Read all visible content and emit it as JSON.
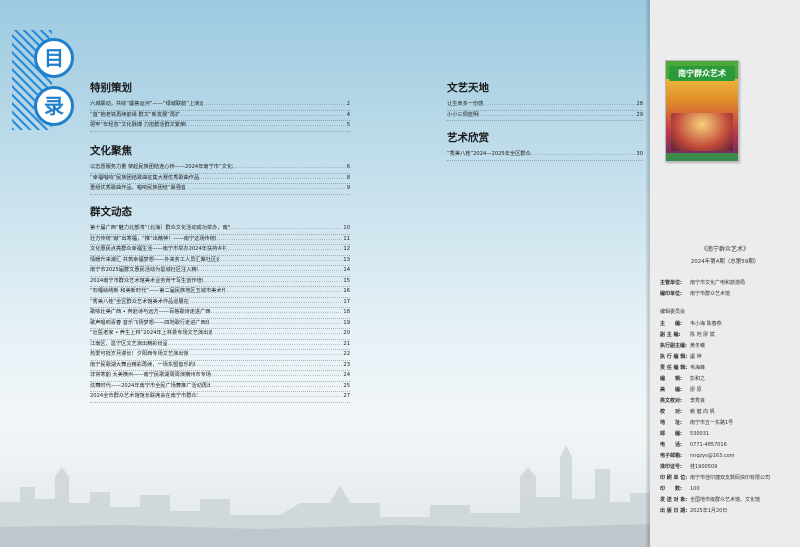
{
  "mulu": [
    "目",
    "录"
  ],
  "left_sections": [
    {
      "title": "特别策划",
      "items": [
        {
          "text": "六城联动，共绘“虞荟运河”——“绿城联韵”上演运河文化盛宴",
          "page": "2"
        },
        {
          "text": "“首”抱老铁再续前缘 群文“新发展”再扩列",
          "page": "4"
        },
        {
          "text": "把牢“年轻态”文化脉搏 力担群活群文繁荣腾跃",
          "page": "5"
        }
      ]
    },
    {
      "title": "文化聚焦",
      "items": [
        {
          "text": "以志愿服务力量 架起民族团结连心桥——2024年南宁市“文化志愿春风行”培训服务活动圆满落幕",
          "page": "6"
        },
        {
          "text": "“幸福唱响”民族团结歌曲征集大赛优秀歌曲作品名录揭晓",
          "page": "8"
        },
        {
          "text": "重组优秀歌曲作品，唱响民族团结“最强音”！",
          "page": "9"
        }
      ]
    },
    {
      "title": "群文动态",
      "items": [
        {
          "text": "第十届广西“魅力北部湾”（北海）群众文化活动成功举办，南宁市群众艺术馆一行赴北海参加活动",
          "page": "10"
        },
        {
          "text": "壮方传统“献”出寒福，“推”出精神！——南宁这场传统剧创作活动养身又润心",
          "page": "11"
        },
        {
          "text": "文化惠民点亮群众幸福生活——南宁市举办2024年扶持乡村社区业余文艺队成果汇报演出",
          "page": "12"
        },
        {
          "text": "情暖升来潮汇 共筑幸福梦想——外来务工人员汇聚社区迎着青阳欢共度欢乐时光",
          "page": "13"
        },
        {
          "text": "南宁市2025届群文惠民活动为邕城社区注入精彩文化能量",
          "page": "14"
        },
        {
          "text": "2024南宁市群众艺术馆美术业务骨干写生创作培训班成功举办",
          "page": "15"
        },
        {
          "text": "“石榴绘绣新 和美新时代”——第二届民族地区五城市美术作品交流展（尼萨站）盛大开幕",
          "page": "16"
        },
        {
          "text": "“秀美八桂”全区群众艺术馆美术作品巡展在展开展",
          "page": "17"
        },
        {
          "text": "歌咏壮美广西 • 奔赴诗与远方——百格歌诗走进广西农业职业技术大学",
          "page": "18"
        },
        {
          "text": "歌声唱响青春 音乐飞扬梦想——四地歌行走进广西体育高等专科学校",
          "page": "19"
        },
        {
          "text": "“壮医老家 • 养生上林”2024年上林县专场文艺演出道党全群艺术惠益力",
          "page": "20"
        },
        {
          "text": "江南区、邕宁区文艺演出精彩纷呈",
          "page": "21"
        },
        {
          "text": "热爱可抵岁月漫长！夕阳西专场文艺演出惊艳全场",
          "page": "22"
        },
        {
          "text": "南宁民歌湖大舞台精彩再续，一场东盟音乐的瑰丽盛宴",
          "page": "23"
        },
        {
          "text": "非常寒韵 大美横州——南宁民歌湖周周演横州市专场文艺演出精彩上演",
          "page": "24"
        },
        {
          "text": "炫舞时代——2024年南宁市全民广场舞推广活动再出精彩，舞出健康",
          "page": "25"
        },
        {
          "text": "2024全市群众艺术馆馆长联席会在南宁市群众艺术馆召开",
          "page": "27"
        }
      ]
    }
  ],
  "middle_sections": [
    {
      "title": "文艺天地",
      "items": [
        {
          "text": "让生命多一份感动",
          "page": "28"
        },
        {
          "text": "小小三侗蓝明歌",
          "page": "29"
        }
      ]
    },
    {
      "title": "艺术欣赏",
      "items": [
        {
          "text": "“秀美八桂”2024—2025年全区群众艺术馆美术作品巡展选登",
          "page": "30"
        }
      ]
    }
  ],
  "cover": {
    "title": "南宁群众艺术"
  },
  "magazine": {
    "title": "《南宁群众艺术》",
    "issue": "2024年第4期（总第59期）"
  },
  "info_top": [
    {
      "label": "主管单位:",
      "value": "南宁市文化广电和旅游局"
    },
    {
      "label": "编印单位:",
      "value": "南宁市群众艺术馆"
    }
  ],
  "info_committee_label": "编辑委员会",
  "info_rows": [
    {
      "label": "主　　编:",
      "value": "韦小海 陈春燕"
    },
    {
      "label": "副 主 编:",
      "value": "陈 地 廖 斌"
    },
    {
      "label": "执行副主编:",
      "value": "黄冬曦"
    },
    {
      "label": "执 行 编 辑:",
      "value": "盧 坤"
    },
    {
      "label": "责 任 编 辑:",
      "value": "韦海峰"
    },
    {
      "label": "编　　辑:",
      "value": "彭和之"
    },
    {
      "label": "美　　编:",
      "value": "廖 原"
    },
    {
      "label": "英文校对:",
      "value": "李秀良"
    },
    {
      "label": "校　　对:",
      "value": "赖 健 向 帆"
    },
    {
      "label": "地　　址:",
      "value": "南宁市五一东路1号"
    },
    {
      "label": "邮　　编:",
      "value": "530031"
    },
    {
      "label": "电　　话:",
      "value": "0771-4857016"
    },
    {
      "label": "电子邮箱:",
      "value": "nnqzys@163.com"
    },
    {
      "label": "准印证号:",
      "value": "桂1900509"
    },
    {
      "label": "印 刷 单 位:",
      "value": "南宁市佳印捷双支数码快印有限公司"
    },
    {
      "label": "印　　数:",
      "value": "100"
    },
    {
      "label": "发 送 对 象:",
      "value": "全国地市级群众艺术馆、文化馆"
    },
    {
      "label": "出 版 日 期:",
      "value": "2025年1月20日"
    }
  ]
}
